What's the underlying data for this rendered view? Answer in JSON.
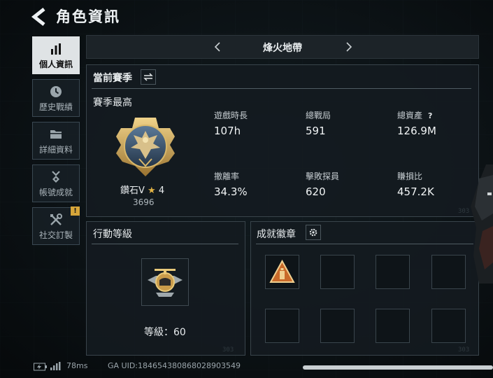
{
  "header": {
    "title": "角色資訊"
  },
  "nav": {
    "items": [
      {
        "label": "個人資訊",
        "icon": "bar-chart-icon",
        "active": true
      },
      {
        "label": "歷史戰績",
        "icon": "clock-icon"
      },
      {
        "label": "詳細資料",
        "icon": "folder-icon"
      },
      {
        "label": "帳號成就",
        "icon": "medal-icon"
      },
      {
        "label": "社交訂製",
        "icon": "tools-icon",
        "badge": "!"
      }
    ]
  },
  "map_selector": {
    "name": "烽火地帶"
  },
  "season": {
    "title": "當前賽季",
    "subtitle": "賽季最高",
    "rank": {
      "name": "鑽石V",
      "star": "★",
      "stars": "4",
      "score": "3696"
    },
    "stats": [
      {
        "label": "遊戲時長",
        "value": "107h"
      },
      {
        "label": "總戰局",
        "value": "591"
      },
      {
        "label": "總資產",
        "value": "126.9M",
        "help": "?"
      },
      {
        "label": "撤離率",
        "value": "34.3%"
      },
      {
        "label": "擊敗探員",
        "value": "620"
      },
      {
        "label": "賺損比",
        "value": "457.2K"
      }
    ]
  },
  "action_level": {
    "title": "行動等級",
    "level_text": "等級：60"
  },
  "achievements": {
    "title": "成就徽章"
  },
  "status_bar": {
    "ping": "78ms",
    "uid": "GA UID:18465438086802890​3549"
  },
  "watermark": "303",
  "colors": {
    "accent_gold": "#d6a53a",
    "active_tab": "#dfe3e5",
    "background": "#0d1418"
  }
}
